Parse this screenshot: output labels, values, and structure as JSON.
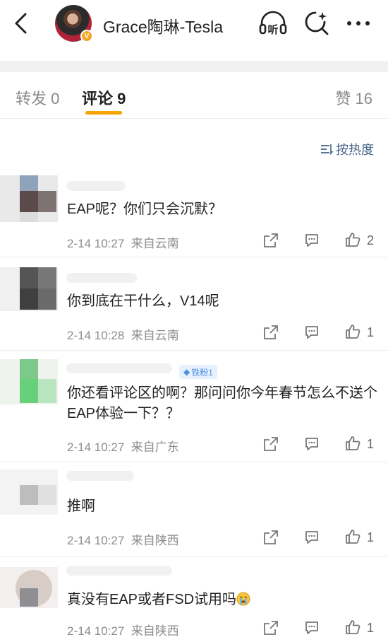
{
  "header": {
    "user_name": "Grace陶琳-Tesla",
    "icons": [
      "back-icon",
      "listen-icon",
      "discover-icon",
      "more-icon"
    ],
    "verified_badge": "V"
  },
  "tabs": {
    "repost": "转发 0",
    "comments": "评论 9",
    "likes": "赞 16",
    "accent": "#f7a500"
  },
  "sort": {
    "label": "按热度",
    "color": "#47668a"
  },
  "comments": [
    {
      "text": "EAP呢？你们只会沉默？",
      "time": "2-14 10:27",
      "location": "来自云南",
      "likes": "2"
    },
    {
      "text": "你到底在干什么，V14呢",
      "time": "2-14 10:28",
      "location": "来自云南",
      "likes": "1"
    },
    {
      "badge": "铁粉1",
      "text": "你还看评论区的啊？那问问你今年春节怎么不送个EAP体验一下？？",
      "time": "2-14 10:27",
      "location": "来自广东",
      "likes": "1"
    },
    {
      "text": "推啊",
      "time": "2-14 10:27",
      "location": "来自陕西",
      "likes": "1"
    },
    {
      "text": "真没有EAP或者FSD试用吗",
      "emoji": "crying-face-icon",
      "time": "2-14 10:27",
      "location": "来自陕西",
      "likes": "1"
    }
  ]
}
